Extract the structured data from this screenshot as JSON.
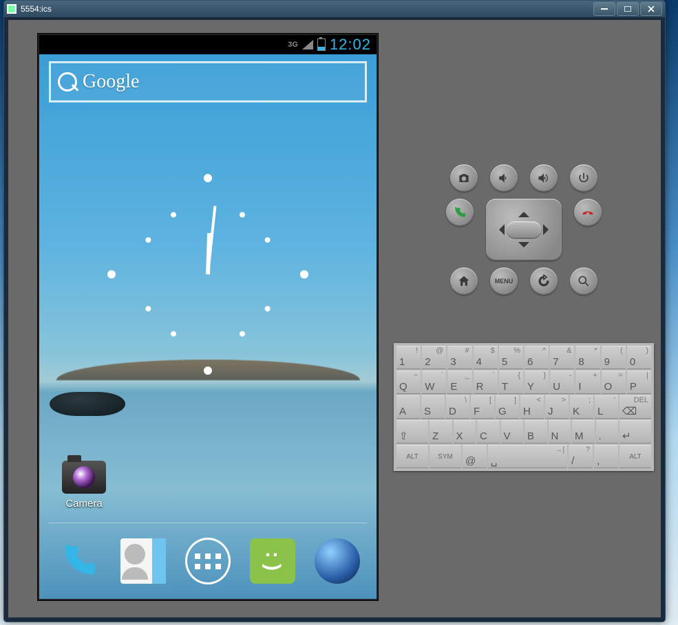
{
  "window": {
    "title": "5554:ics"
  },
  "statusbar": {
    "network": "3G",
    "time": "12:02"
  },
  "search": {
    "label": "Google"
  },
  "home_app": {
    "label": "Camera"
  },
  "dock": {
    "phone": "Phone",
    "contacts": "Contacts",
    "apps": "Apps",
    "messaging": "Messaging",
    "browser": "Browser"
  },
  "hw": {
    "menu_label": "MENU"
  },
  "keyboard": {
    "row1": [
      {
        "m": "1",
        "a": "!"
      },
      {
        "m": "2",
        "a": "@"
      },
      {
        "m": "3",
        "a": "#"
      },
      {
        "m": "4",
        "a": "$"
      },
      {
        "m": "5",
        "a": "%"
      },
      {
        "m": "6",
        "a": "^"
      },
      {
        "m": "7",
        "a": "&"
      },
      {
        "m": "8",
        "a": "*"
      },
      {
        "m": "9",
        "a": "("
      },
      {
        "m": "0",
        "a": ")"
      }
    ],
    "row2": [
      {
        "m": "Q",
        "a": "~"
      },
      {
        "m": "W",
        "a": "`"
      },
      {
        "m": "E",
        "a": "_"
      },
      {
        "m": "R",
        "a": "`"
      },
      {
        "m": "T",
        "a": "{"
      },
      {
        "m": "Y",
        "a": "}"
      },
      {
        "m": "U",
        "a": "-"
      },
      {
        "m": "I",
        "a": "+"
      },
      {
        "m": "O",
        "a": "="
      },
      {
        "m": "P",
        "a": "|"
      }
    ],
    "row3": [
      {
        "m": "A",
        "a": ""
      },
      {
        "m": "S",
        "a": ""
      },
      {
        "m": "D",
        "a": "\\"
      },
      {
        "m": "F",
        "a": "["
      },
      {
        "m": "G",
        "a": "]"
      },
      {
        "m": "H",
        "a": "<"
      },
      {
        "m": "J",
        "a": ">"
      },
      {
        "m": "K",
        "a": ";"
      },
      {
        "m": "L",
        "a": "'"
      }
    ],
    "row3_del": "DEL",
    "row4": [
      {
        "m": "Z"
      },
      {
        "m": "X"
      },
      {
        "m": "C"
      },
      {
        "m": "V"
      },
      {
        "m": "B"
      },
      {
        "m": "N"
      },
      {
        "m": "M"
      },
      {
        "m": "."
      }
    ],
    "row5": {
      "alt": "ALT",
      "sym": "SYM",
      "at": "@",
      "comma": ",",
      "slash": "/",
      "q": "?"
    }
  }
}
